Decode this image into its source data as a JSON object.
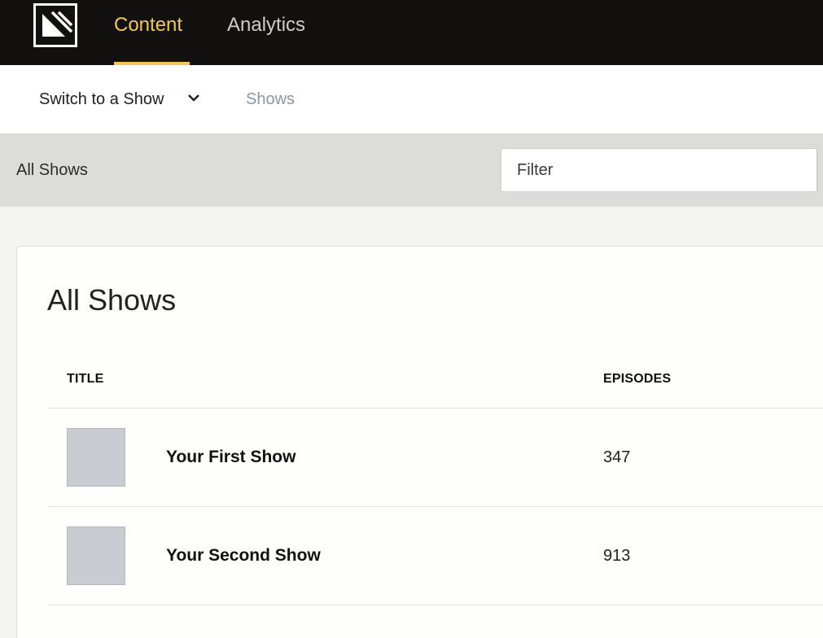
{
  "topnav": {
    "logo_icon": "brand-logo-icon",
    "tabs": [
      {
        "label": "Content",
        "active": true
      },
      {
        "label": "Analytics",
        "active": false
      }
    ],
    "active_color": "#f2c94c",
    "background_color": "#121110"
  },
  "subnav": {
    "switch_label": "Switch to a Show",
    "switch_icon": "chevron-down-icon",
    "breadcrumb": "Shows"
  },
  "filterbar": {
    "label": "All Shows",
    "filter_placeholder": "Filter",
    "filter_value": ""
  },
  "card": {
    "title": "All Shows",
    "columns": {
      "title": "TITLE",
      "episodes": "EPISODES"
    },
    "rows": [
      {
        "title": "Your First Show",
        "episodes": "347",
        "thumbnail_icon": "show-thumbnail-placeholder"
      },
      {
        "title": "Your Second Show",
        "episodes": "913",
        "thumbnail_icon": "show-thumbnail-placeholder"
      }
    ]
  }
}
